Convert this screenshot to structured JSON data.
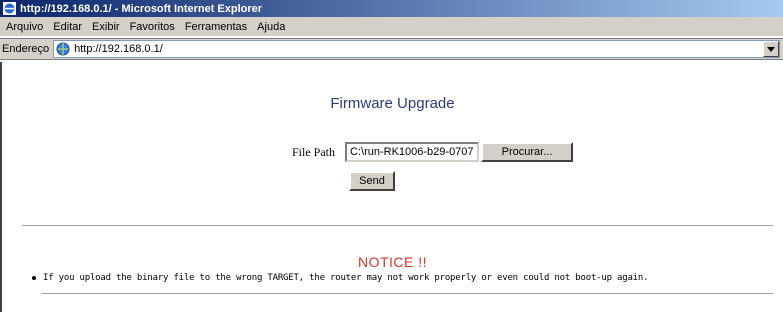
{
  "window": {
    "title": "http://192.168.0.1/ - Microsoft Internet Explorer"
  },
  "menubar": {
    "items": [
      {
        "label": "Arquivo"
      },
      {
        "label": "Editar"
      },
      {
        "label": "Exibir"
      },
      {
        "label": "Favoritos"
      },
      {
        "label": "Ferramentas"
      },
      {
        "label": "Ajuda"
      }
    ]
  },
  "addressbar": {
    "label": "Endereço",
    "url": "http://192.168.0.1/"
  },
  "page": {
    "title": "Firmware Upgrade",
    "file_path_label": "File Path",
    "file_path_value": "C:\\run-RK1006-b29-0707",
    "browse_label": "Procurar...",
    "send_label": "Send",
    "notice_title": "NOTICE !!",
    "notice_text": "If you upload the binary file to the wrong TARGET, the router may not work properly or even could not boot-up again."
  },
  "colors": {
    "title_color": "#2c3a7a",
    "notice_color": "#d9362a",
    "titlebar_start": "#0a246a",
    "chrome": "#d4d0c8"
  },
  "icons": {
    "window_icon": "ie-icon",
    "address_icon": "globe-icon",
    "dropdown_icon": "chevron-down-icon"
  }
}
